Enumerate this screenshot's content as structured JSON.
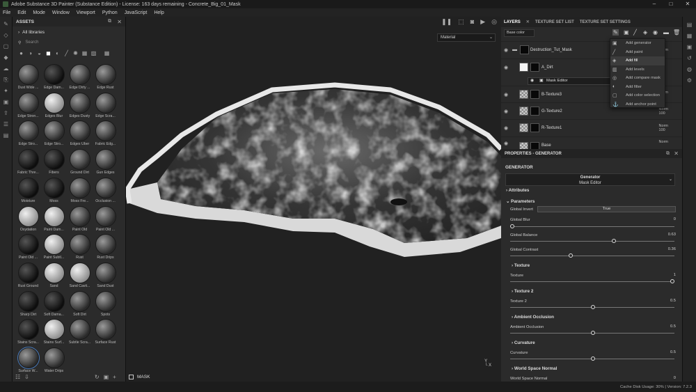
{
  "window": {
    "title": "Adobe Substance 3D Painter (Substance Edition) - License: 163 days remaining - Concrete_Big_01_Mask",
    "controls": [
      "–",
      "□",
      "✕"
    ]
  },
  "menu": [
    "File",
    "Edit",
    "Mode",
    "Window",
    "Viewport",
    "Python",
    "JavaScript",
    "Help"
  ],
  "assets": {
    "title": "ASSETS",
    "library": "All libraries",
    "search_placeholder": "Search",
    "items": [
      "Dust Wide ...",
      "Edge Dam...",
      "Edge Dirty ...",
      "Edge Rust",
      "Edge Stron...",
      "Edges Blur",
      "Edges Dusty",
      "Edge Scra...",
      "Edge Stro...",
      "Edge Stro...",
      "Edges Uber",
      "Fabric Edg...",
      "Fabric Thre...",
      "Fibers",
      "Ground Dirt",
      "Gun Edges",
      "Moisture",
      "Moss",
      "Moss Fre...",
      "Occlusion ...",
      "Oxydation",
      "Paint Dam...",
      "Paint Old",
      "Paint Old ...",
      "Paint Old ...",
      "Paint Subtl...",
      "Rust",
      "Rust Drips",
      "Rust Ground",
      "Sand",
      "Sand Cavit...",
      "Sand Dust",
      "Sharp Dirt",
      "Soft Dama...",
      "Soft Dirt",
      "Spots",
      "Stains Scra...",
      "Stains Surf...",
      "Subtle Scra...",
      "Surface Rust",
      "Surface W...",
      "Water Drips"
    ]
  },
  "viewport": {
    "material_select": "Material",
    "mode_label": "MASK",
    "axis": "Y\nX"
  },
  "layers_panel": {
    "tabs": [
      "LAYERS",
      "TEXTURE SET LIST",
      "TEXTURE SET SETTINGS"
    ],
    "channel": "Base color",
    "rows": [
      {
        "name": "Destruction_Tut_Mask",
        "blend": "Norm",
        "opacity": ""
      },
      {
        "name": "A_Dirt",
        "blend": "",
        "opacity": ""
      },
      {
        "name": "B-Texture3",
        "blend": "Norm",
        "opacity": "100"
      },
      {
        "name": "G-Texture2",
        "blend": "Norm",
        "opacity": "100"
      },
      {
        "name": "R-Texture1",
        "blend": "Norm",
        "opacity": "100"
      },
      {
        "name": "Base",
        "blend": "Norm",
        "opacity": ""
      }
    ],
    "mask_editor": "Mask Editor",
    "menu": [
      "Add generator",
      "Add paint",
      "Add fill",
      "Add levels",
      "Add compare mask",
      "Add filter",
      "Add color selection",
      "Add anchor point"
    ]
  },
  "properties": {
    "title": "PROPERTIES - GENERATOR",
    "section": "GENERATOR",
    "generator_name": "Generator",
    "generator_sub": "Mask Editor",
    "attributes": "Attributes",
    "parameters": "Parameters",
    "global_invert_label": "Global Invert",
    "global_invert_value": "True",
    "global_blur_label": "Global Blur",
    "global_blur_value": "0",
    "global_balance_label": "Global Balance",
    "global_balance_value": "0.63",
    "global_contrast_label": "Global Contrast",
    "global_contrast_value": "0.36",
    "texture_sec": "Texture",
    "texture_label": "Texture",
    "texture_value": "1",
    "texture2_sec": "Texture 2",
    "texture2_label": "Texture 2",
    "texture2_value": "0.5",
    "ao_sec": "Ambient Occlusion",
    "ao_label": "Ambient Occlusion",
    "ao_value": "0.5",
    "curv_sec": "Curvature",
    "curv_label": "Curvature",
    "curv_value": "0.5",
    "wsn_sec": "World Space Normal",
    "wsn_label": "World Space Normal",
    "wsn_value": "0"
  },
  "status_bar": "Cache Disk Usage:    30%  |  Version: 7.2.3"
}
